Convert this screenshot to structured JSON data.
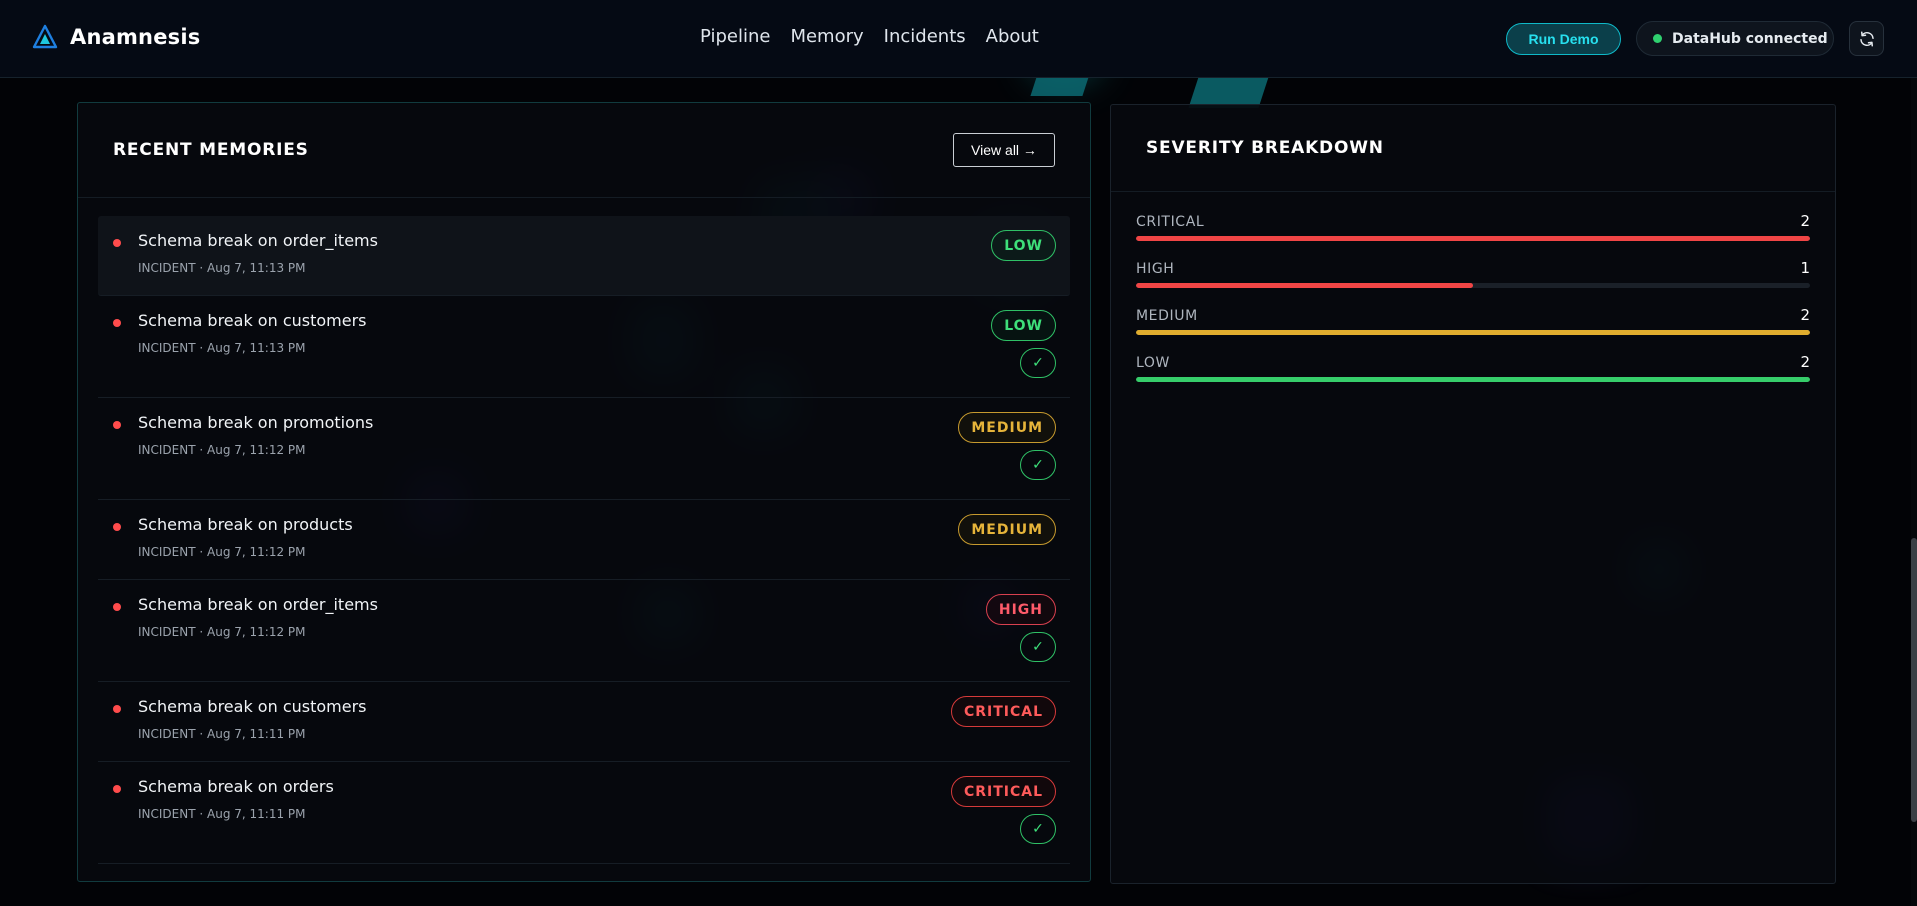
{
  "brand": {
    "name": "Anamnesis"
  },
  "nav": {
    "items": [
      "Pipeline",
      "Memory",
      "Incidents",
      "About"
    ]
  },
  "header": {
    "run_demo_label": "Run Demo",
    "status_label": "DataHub connected",
    "status_color": "#2fd06f"
  },
  "icons": {
    "brand": "triangle-logo-icon",
    "refresh": "refresh-icon",
    "check": "check-icon"
  },
  "recent": {
    "title": "RECENT MEMORIES",
    "view_all_label": "View all →",
    "items": [
      {
        "title": "Schema break on order_items",
        "meta": "INCIDENT · Aug 7, 11:13 PM",
        "severity": "LOW",
        "checked": false,
        "highlight": true
      },
      {
        "title": "Schema break on customers",
        "meta": "INCIDENT · Aug 7, 11:13 PM",
        "severity": "LOW",
        "checked": true,
        "highlight": false
      },
      {
        "title": "Schema break on promotions",
        "meta": "INCIDENT · Aug 7, 11:12 PM",
        "severity": "MEDIUM",
        "checked": true,
        "highlight": false
      },
      {
        "title": "Schema break on products",
        "meta": "INCIDENT · Aug 7, 11:12 PM",
        "severity": "MEDIUM",
        "checked": false,
        "highlight": false
      },
      {
        "title": "Schema break on order_items",
        "meta": "INCIDENT · Aug 7, 11:12 PM",
        "severity": "HIGH",
        "checked": true,
        "highlight": false
      },
      {
        "title": "Schema break on customers",
        "meta": "INCIDENT · Aug 7, 11:11 PM",
        "severity": "CRITICAL",
        "checked": false,
        "highlight": false
      },
      {
        "title": "Schema break on orders",
        "meta": "INCIDENT · Aug 7, 11:11 PM",
        "severity": "CRITICAL",
        "checked": true,
        "highlight": false
      }
    ],
    "check_glyph": "✓"
  },
  "severity": {
    "title": "SEVERITY BREAKDOWN",
    "items": [
      {
        "label": "CRITICAL",
        "count": "2",
        "fraction": 1.0,
        "color": "#f04545"
      },
      {
        "label": "HIGH",
        "count": "1",
        "fraction": 0.5,
        "color": "#f04545"
      },
      {
        "label": "MEDIUM",
        "count": "2",
        "fraction": 1.0,
        "color": "#e0ad2e"
      },
      {
        "label": "LOW",
        "count": "2",
        "fraction": 1.0,
        "color": "#36cd6a"
      }
    ]
  },
  "colors": {
    "accent": "#27e0ef",
    "low": "#3ee07a",
    "medium": "#e6b43a",
    "high": "#ff5b6a",
    "critical": "#ff5b5b"
  }
}
